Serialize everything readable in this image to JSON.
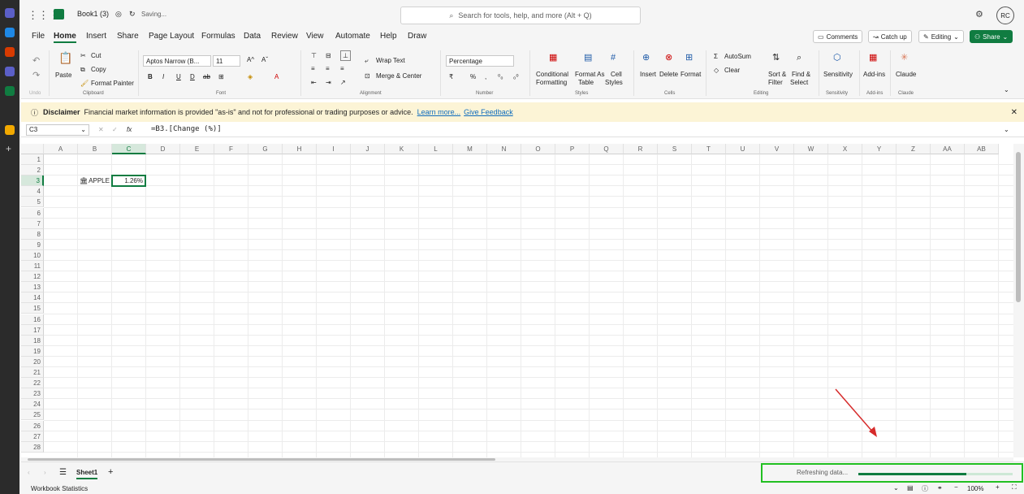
{
  "app": {
    "title": "Book1 (3)",
    "status": "Saving..."
  },
  "search": {
    "placeholder": "Search for tools, help, and more (Alt + Q)"
  },
  "user": {
    "initials": "RC"
  },
  "menu": {
    "tabs": [
      "File",
      "Home",
      "Insert",
      "Share",
      "Page Layout",
      "Formulas",
      "Data",
      "Review",
      "View",
      "Automate",
      "Help",
      "Draw"
    ],
    "active": "Home"
  },
  "header_buttons": {
    "comments": "Comments",
    "catchup": "Catch up",
    "editing": "Editing",
    "share": "Share"
  },
  "ribbon": {
    "clipboard": {
      "paste": "Paste",
      "cut": "Cut",
      "copy": "Copy",
      "format_painter": "Format Painter",
      "label": "Clipboard",
      "undo_label": "Undo"
    },
    "font": {
      "name": "Aptos Narrow (B...",
      "size": "11",
      "label": "Font"
    },
    "alignment": {
      "wrap": "Wrap Text",
      "merge": "Merge & Center",
      "label": "Alignment"
    },
    "number": {
      "format": "Percentage",
      "label": "Number"
    },
    "styles": {
      "conditional": "Conditional",
      "conditional2": "Formatting",
      "format_as": "Format As",
      "format_as2": "Table",
      "cell": "Cell",
      "cell2": "Styles",
      "label": "Styles"
    },
    "cells": {
      "insert": "Insert",
      "delete": "Delete",
      "format": "Format",
      "label": "Cells"
    },
    "editing": {
      "autosum": "AutoSum",
      "clear": "Clear",
      "sort": "Sort &",
      "sort2": "Filter",
      "find": "Find &",
      "find2": "Select",
      "label": "Editing"
    },
    "sensitivity": {
      "btn": "Sensitivity",
      "label": "Sensitivity"
    },
    "addins": {
      "btn": "Add-ins",
      "label": "Add-ins"
    },
    "claude": {
      "btn": "Claude",
      "label": "Claude"
    }
  },
  "disclaimer": {
    "title": "Disclaimer",
    "text": "Financial market information is provided \"as-is\" and not for professional or trading purposes or advice.",
    "learn": "Learn more...",
    "feedback": "Give Feedback"
  },
  "formula_bar": {
    "cell": "C3",
    "formula": "=B3.[Change (%)]"
  },
  "columns": [
    "A",
    "B",
    "C",
    "D",
    "E",
    "F",
    "G",
    "H",
    "I",
    "J",
    "K",
    "L",
    "M",
    "N",
    "O",
    "P",
    "Q",
    "R",
    "S",
    "T",
    "U",
    "V",
    "W",
    "X",
    "Y",
    "Z",
    "AA",
    "AB"
  ],
  "rows": [
    "1",
    "2",
    "3",
    "4",
    "5",
    "6",
    "7",
    "8",
    "9",
    "10",
    "11",
    "12",
    "13",
    "14",
    "15",
    "16",
    "17",
    "18",
    "19",
    "20",
    "21",
    "22",
    "23",
    "24",
    "25",
    "26",
    "27",
    "28"
  ],
  "cells": {
    "b3": "APPLE I",
    "c3": "1.26%"
  },
  "sheet": {
    "name": "Sheet1"
  },
  "status": {
    "workbook_stats": "Workbook Statistics",
    "refreshing": "Refreshing data...",
    "zoom": "100%"
  }
}
